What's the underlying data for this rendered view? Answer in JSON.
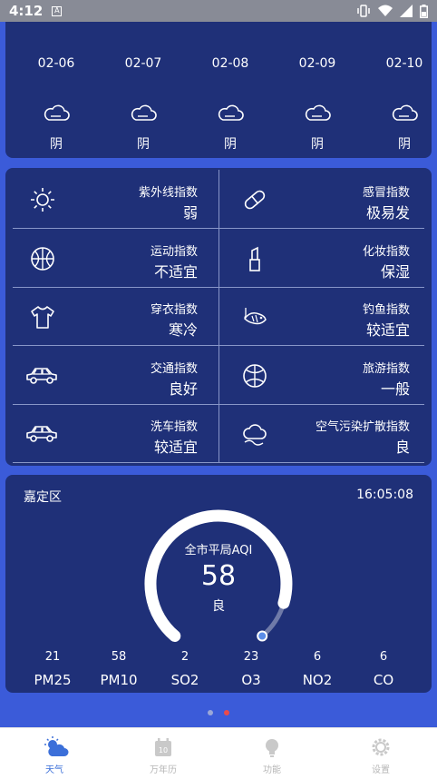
{
  "status_bar": {
    "time": "4:12",
    "notification_letter": "A"
  },
  "forecast": [
    {
      "date": "02-06",
      "condition": "阴",
      "icon": "cloudy-icon"
    },
    {
      "date": "02-07",
      "condition": "阴",
      "icon": "cloudy-icon"
    },
    {
      "date": "02-08",
      "condition": "阴",
      "icon": "cloudy-icon"
    },
    {
      "date": "02-09",
      "condition": "阴",
      "icon": "cloudy-icon"
    },
    {
      "date": "02-10",
      "condition": "阴",
      "icon": "cloudy-icon"
    }
  ],
  "indices": [
    {
      "name": "紫外线指数",
      "value": "弱",
      "icon": "sun-icon"
    },
    {
      "name": "感冒指数",
      "value": "极易发",
      "icon": "pill-icon"
    },
    {
      "name": "运动指数",
      "value": "不适宜",
      "icon": "basketball-icon"
    },
    {
      "name": "化妆指数",
      "value": "保湿",
      "icon": "lipstick-icon"
    },
    {
      "name": "穿衣指数",
      "value": "寒冷",
      "icon": "tshirt-icon"
    },
    {
      "name": "钓鱼指数",
      "value": "较适宜",
      "icon": "fish-icon"
    },
    {
      "name": "交通指数",
      "value": "良好",
      "icon": "car-icon"
    },
    {
      "name": "旅游指数",
      "value": "一般",
      "icon": "ball-icon"
    },
    {
      "name": "洗车指数",
      "value": "较适宜",
      "icon": "car-icon"
    },
    {
      "name": "空气污染扩散指数",
      "value": "良",
      "icon": "haze-icon"
    }
  ],
  "aqi": {
    "district": "嘉定区",
    "update_time": "16:05:08",
    "title": "全市平局AQI",
    "value": "58",
    "level": "良",
    "gauge_fraction": 0.12,
    "pollutants": [
      {
        "value": "21",
        "name": "PM25"
      },
      {
        "value": "58",
        "name": "PM10"
      },
      {
        "value": "2",
        "name": "SO2"
      },
      {
        "value": "23",
        "name": "O3"
      },
      {
        "value": "6",
        "name": "NO2"
      },
      {
        "value": "6",
        "name": "CO"
      }
    ]
  },
  "pager": {
    "pages": 2,
    "active": 1
  },
  "tabs": [
    {
      "label": "天气",
      "icon": "weather-icon",
      "active": true
    },
    {
      "label": "万年历",
      "icon": "calendar-icon",
      "active": false
    },
    {
      "label": "功能",
      "icon": "bulb-icon",
      "active": false
    },
    {
      "label": "设置",
      "icon": "gear-icon",
      "active": false
    }
  ],
  "colors": {
    "background": "#3b5bd9",
    "card": "#1f3078",
    "tab_active": "#3b6fd9",
    "pager_active": "#e94a4a"
  }
}
